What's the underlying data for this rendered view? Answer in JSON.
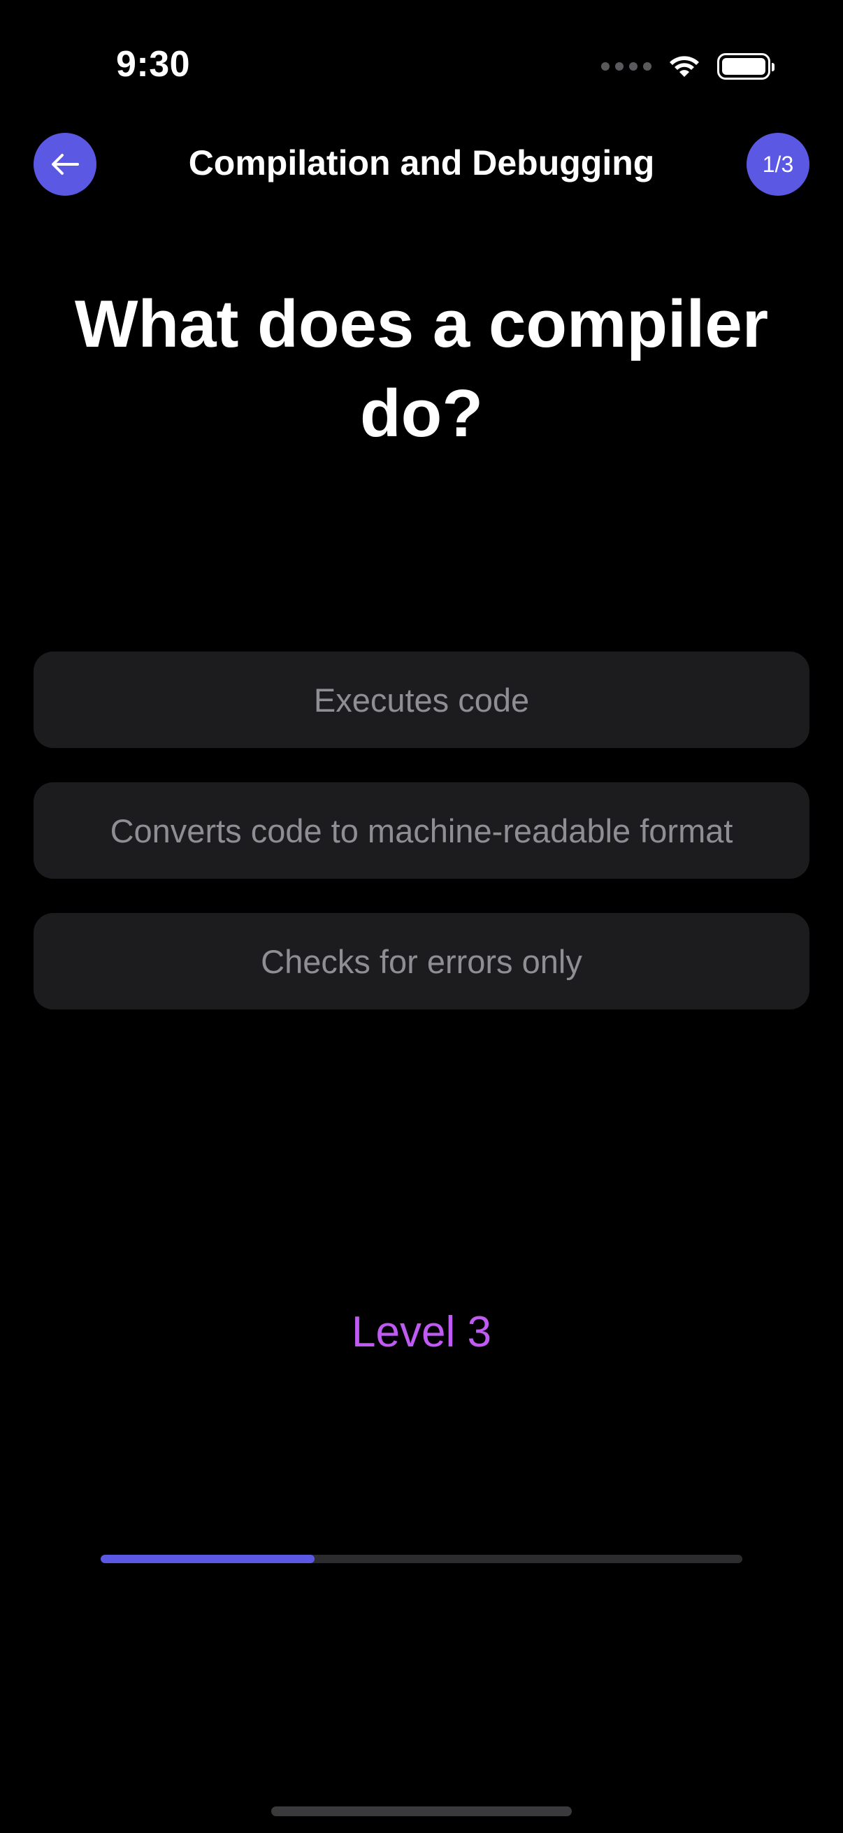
{
  "status_bar": {
    "time": "9:30",
    "icons": [
      "cellular-signal-icon",
      "wifi-icon",
      "battery-icon"
    ]
  },
  "header": {
    "back_icon": "arrow-left-icon",
    "title": "Compilation and Debugging",
    "progress_badge": "1/3"
  },
  "question": {
    "text": "What does a compiler do?"
  },
  "answers": [
    {
      "label": "Executes code"
    },
    {
      "label": "Converts code to machine-readable format"
    },
    {
      "label": "Checks for errors only"
    }
  ],
  "level": {
    "label": "Level 3"
  },
  "progress": {
    "value_fraction": 0.333
  },
  "colors": {
    "accent": "#5b58e4",
    "level_text": "#bf5af2",
    "background": "#000000",
    "answer_background": "#1c1c1e",
    "answer_text": "#8e8e93"
  }
}
